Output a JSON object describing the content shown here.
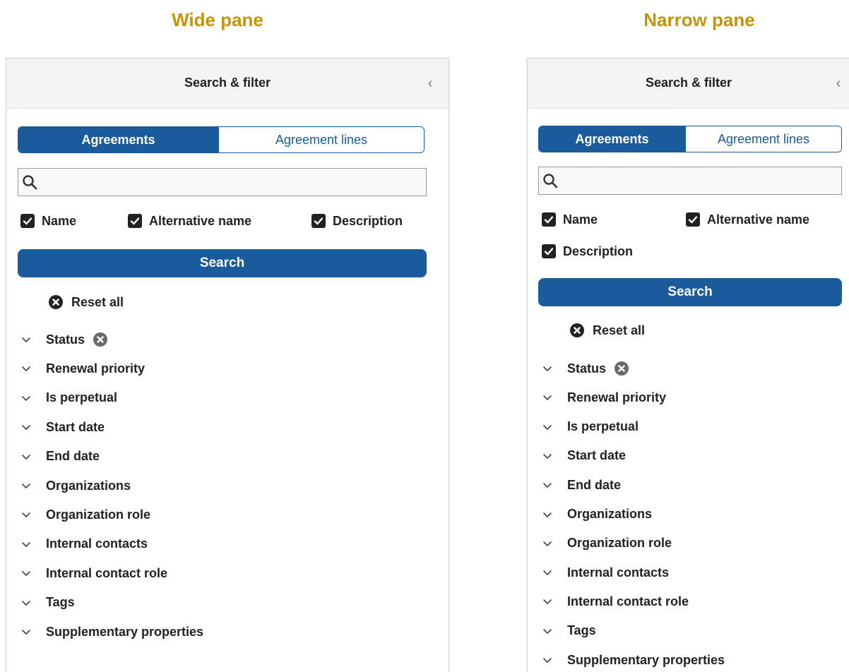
{
  "headings": {
    "wide": "Wide pane",
    "narrow": "Narrow pane"
  },
  "pane": {
    "title": "Search & filter",
    "collapse_glyph": "‹",
    "tabs": [
      "Agreements",
      "Agreement lines"
    ],
    "active_tab": "Agreements",
    "search": {
      "value": "",
      "placeholder": ""
    },
    "checkboxes": [
      {
        "label": "Name",
        "checked": true
      },
      {
        "label": "Alternative name",
        "checked": true
      },
      {
        "label": "Description",
        "checked": true
      }
    ],
    "search_button": "Search",
    "reset_all": "Reset all",
    "filters": [
      "Status",
      "Renewal priority",
      "Is perpetual",
      "Start date",
      "End date",
      "Organizations",
      "Organization role",
      "Internal contacts",
      "Internal contact role",
      "Tags",
      "Supplementary properties"
    ]
  },
  "colors": {
    "heading": "#c79406",
    "primary": "#1a5b9b",
    "header_bg": "#f4f4f4",
    "text": "#222222"
  },
  "icons": {
    "search": "magnifier-icon",
    "checkbox": "checkmark-icon",
    "reset": "x-circle-icon",
    "filter": "chevron-down-icon",
    "collapse": "chevron-left-icon"
  }
}
